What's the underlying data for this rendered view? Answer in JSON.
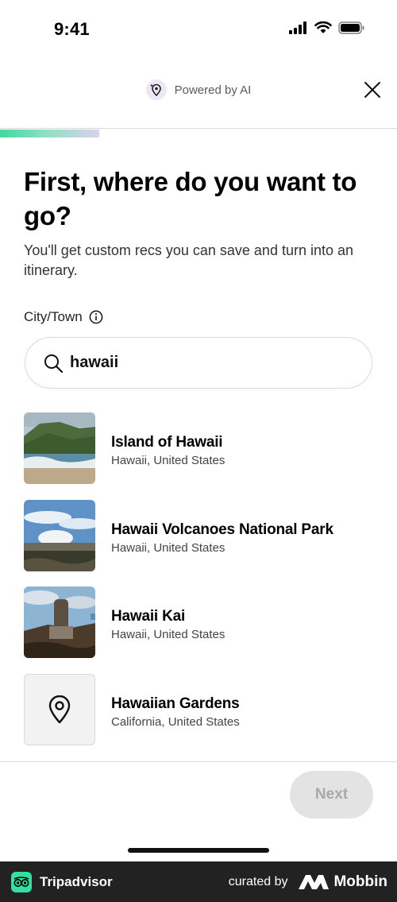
{
  "status_bar": {
    "time": "9:41"
  },
  "header": {
    "powered_label": "Powered by AI"
  },
  "progress": {
    "fraction": 0.25
  },
  "title": "First, where do you want to go?",
  "subtitle": "You'll get custom recs you can save and turn into an itinerary.",
  "field": {
    "label": "City/Town",
    "value": "hawaii",
    "placeholder": ""
  },
  "results": [
    {
      "name": "Island of Hawaii",
      "location": "Hawaii, United States",
      "thumb": "photo-beach"
    },
    {
      "name": "Hawaii Volcanoes National Park",
      "location": "Hawaii, United States",
      "thumb": "photo-volcano"
    },
    {
      "name": "Hawaii Kai",
      "location": "Hawaii, United States",
      "thumb": "photo-monument"
    },
    {
      "name": "Hawaiian Gardens",
      "location": "California, United States",
      "thumb": "map-pin-icon"
    }
  ],
  "actions": {
    "next_label": "Next"
  },
  "footer": {
    "brand": "Tripadvisor",
    "curated": "curated by",
    "mobbin": "Mobbin"
  },
  "colors": {
    "accent": "#34e0a1",
    "ai_badge": "#ece6f7",
    "disabled_button": "#e3e3e3",
    "footer_bg": "#222222"
  }
}
